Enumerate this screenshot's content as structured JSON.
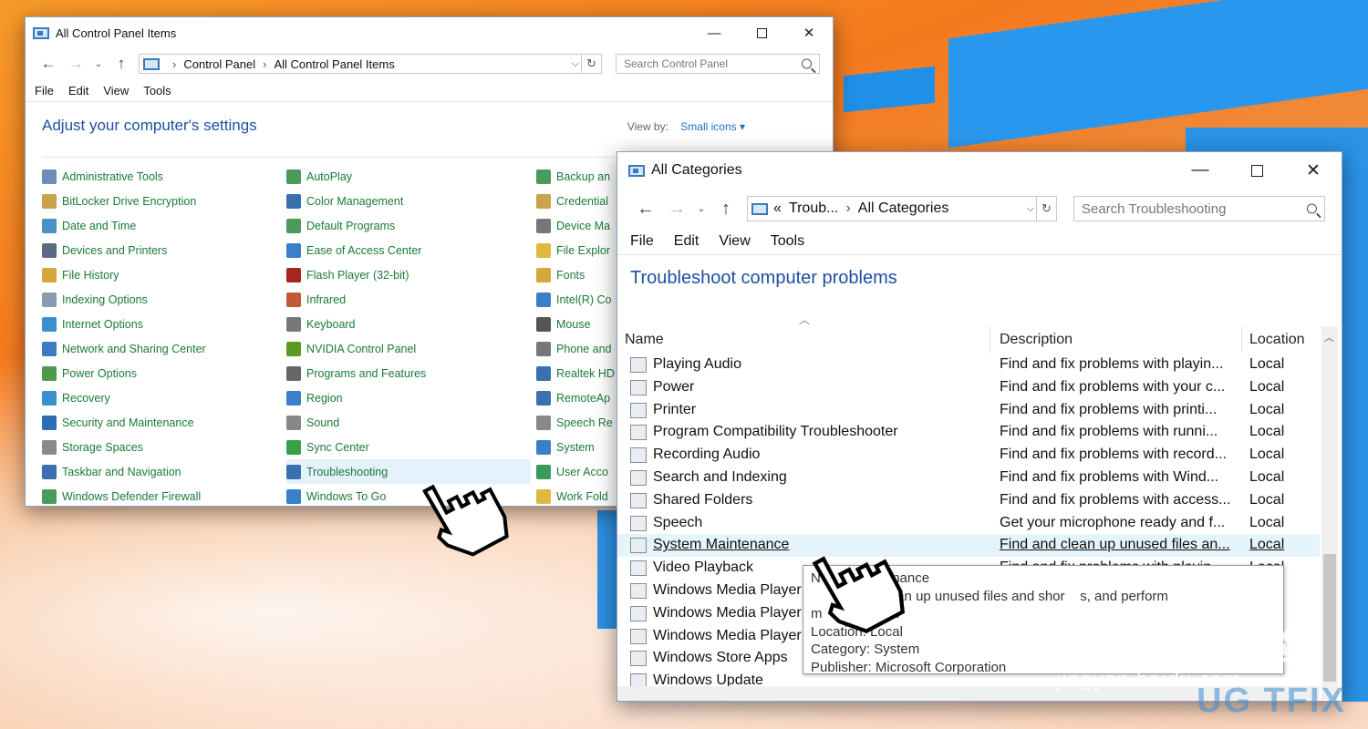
{
  "control_panel": {
    "title": "All Control Panel Items",
    "nav": {
      "back": "←",
      "forward": "→",
      "recent": "⌄",
      "up": "↑"
    },
    "breadcrumb": [
      "Control Panel",
      "All Control Panel Items"
    ],
    "search_placeholder": "Search Control Panel",
    "menu": [
      "File",
      "Edit",
      "View",
      "Tools"
    ],
    "heading": "Adjust your computer's settings",
    "view_by_label": "View by:",
    "view_by_value": "Small icons ▾",
    "columns": [
      [
        {
          "label": "Administrative Tools",
          "icon": "admin-tools-icon",
          "color": "#6c8fb8"
        },
        {
          "label": "BitLocker Drive Encryption",
          "icon": "bitlocker-icon",
          "color": "#c9a24a"
        },
        {
          "label": "Date and Time",
          "icon": "clock-icon",
          "color": "#4a90c9"
        },
        {
          "label": "Devices and Printers",
          "icon": "printer-icon",
          "color": "#5a6d80"
        },
        {
          "label": "File History",
          "icon": "file-history-icon",
          "color": "#d4a93c"
        },
        {
          "label": "Indexing Options",
          "icon": "indexing-icon",
          "color": "#8a9bb0"
        },
        {
          "label": "Internet Options",
          "icon": "globe-icon",
          "color": "#3a8fcf"
        },
        {
          "label": "Network and Sharing Center",
          "icon": "network-icon",
          "color": "#3d7cc0"
        },
        {
          "label": "Power Options",
          "icon": "power-icon",
          "color": "#4f9a4a"
        },
        {
          "label": "Recovery",
          "icon": "recovery-icon",
          "color": "#3a8fcf"
        },
        {
          "label": "Security and Maintenance",
          "icon": "flag-icon",
          "color": "#2e6db4"
        },
        {
          "label": "Storage Spaces",
          "icon": "storage-icon",
          "color": "#8a8a8a"
        },
        {
          "label": "Taskbar and Navigation",
          "icon": "taskbar-icon",
          "color": "#3a6fb0"
        },
        {
          "label": "Windows Defender Firewall",
          "icon": "firewall-icon",
          "color": "#4a9a5a"
        }
      ],
      [
        {
          "label": "AutoPlay",
          "icon": "autoplay-icon",
          "color": "#4a9a5a"
        },
        {
          "label": "Color Management",
          "icon": "color-icon",
          "color": "#3a6fb0"
        },
        {
          "label": "Default Programs",
          "icon": "default-programs-icon",
          "color": "#4a9a5a"
        },
        {
          "label": "Ease of Access Center",
          "icon": "ease-access-icon",
          "color": "#3a7fc9"
        },
        {
          "label": "Flash Player (32-bit)",
          "icon": "flash-icon",
          "color": "#a8241e"
        },
        {
          "label": "Infrared",
          "icon": "infrared-icon",
          "color": "#c25a3a"
        },
        {
          "label": "Keyboard",
          "icon": "keyboard-icon",
          "color": "#777777"
        },
        {
          "label": "NVIDIA Control Panel",
          "icon": "nvidia-icon",
          "color": "#5a9a22"
        },
        {
          "label": "Programs and Features",
          "icon": "programs-icon",
          "color": "#666666"
        },
        {
          "label": "Region",
          "icon": "region-icon",
          "color": "#3a7fc9"
        },
        {
          "label": "Sound",
          "icon": "sound-icon",
          "color": "#888888"
        },
        {
          "label": "Sync Center",
          "icon": "sync-icon",
          "color": "#3aa04a"
        },
        {
          "label": "Troubleshooting",
          "icon": "troubleshooting-icon",
          "color": "#3a6fb0"
        },
        {
          "label": "Windows To Go",
          "icon": "windows-to-go-icon",
          "color": "#3a7fc9"
        }
      ],
      [
        {
          "label": "Backup an",
          "icon": "backup-icon",
          "color": "#4a9a5a"
        },
        {
          "label": "Credential",
          "icon": "credential-icon",
          "color": "#c9a24a"
        },
        {
          "label": "Device Ma",
          "icon": "device-manager-icon",
          "color": "#777777"
        },
        {
          "label": "File Explor",
          "icon": "folder-icon",
          "color": "#e0b840"
        },
        {
          "label": "Fonts",
          "icon": "fonts-icon",
          "color": "#d4a93c"
        },
        {
          "label": "Intel(R) Co",
          "icon": "intel-icon",
          "color": "#3a7fc9"
        },
        {
          "label": "Mouse",
          "icon": "mouse-icon",
          "color": "#555555"
        },
        {
          "label": "Phone and",
          "icon": "phone-icon",
          "color": "#777777"
        },
        {
          "label": "Realtek HD",
          "icon": "realtek-icon",
          "color": "#3a6fb0"
        },
        {
          "label": "RemoteAp",
          "icon": "remoteapp-icon",
          "color": "#3a6fb0"
        },
        {
          "label": "Speech Re",
          "icon": "microphone-icon",
          "color": "#888888"
        },
        {
          "label": "System",
          "icon": "system-icon",
          "color": "#3a7fc9"
        },
        {
          "label": "User Acco",
          "icon": "user-accounts-icon",
          "color": "#3a9a5a"
        },
        {
          "label": "Work Fold",
          "icon": "work-folders-icon",
          "color": "#e0b840"
        }
      ]
    ]
  },
  "troubleshoot": {
    "title": "All Categories",
    "nav": {
      "back": "←",
      "forward": "→",
      "recent": "⌄",
      "up": "↑"
    },
    "breadcrumb_prefix": "«",
    "breadcrumb": [
      "Troub...",
      "All Categories"
    ],
    "search_placeholder": "Search Troubleshooting",
    "menu": [
      "File",
      "Edit",
      "View",
      "Tools"
    ],
    "heading": "Troubleshoot computer problems",
    "columns": {
      "name": "Name",
      "description": "Description",
      "location": "Location"
    },
    "rows": [
      {
        "name": "Playing Audio",
        "description": "Find and fix problems with playin...",
        "location": "Local"
      },
      {
        "name": "Power",
        "description": "Find and fix problems with your c...",
        "location": "Local"
      },
      {
        "name": "Printer",
        "description": "Find and fix problems with printi...",
        "location": "Local"
      },
      {
        "name": "Program Compatibility Troubleshooter",
        "description": "Find and fix problems with runni...",
        "location": "Local"
      },
      {
        "name": "Recording Audio",
        "description": "Find and fix problems with record...",
        "location": "Local"
      },
      {
        "name": "Search and Indexing",
        "description": "Find and fix problems with Wind...",
        "location": "Local"
      },
      {
        "name": "Shared Folders",
        "description": "Find and fix problems with access...",
        "location": "Local"
      },
      {
        "name": "Speech",
        "description": "Get your microphone ready and f...",
        "location": "Local"
      },
      {
        "name": "System Maintenance",
        "description": "Find and clean up unused files an...",
        "location": "Local",
        "highlighted": true
      },
      {
        "name": "Video Playback",
        "description": "Find and fix problems with playin...",
        "location": "Local"
      },
      {
        "name": "Windows Media Player",
        "description": "",
        "location": ""
      },
      {
        "name": "Windows Media Player",
        "description": "",
        "location": ""
      },
      {
        "name": "Windows Media Player",
        "description": "",
        "location": ""
      },
      {
        "name": "Windows Store Apps",
        "description": "",
        "location": ""
      },
      {
        "name": "Windows Update",
        "description": "",
        "location": ""
      }
    ],
    "tooltip": {
      "line1": "N        Maintenance",
      "line2": "        d and clean up unused files and shor    s, and perform",
      "line3": "m              sks.",
      "line4": "Location: Local",
      "line5": "Category: System",
      "line6": "Publisher: Microsoft Corporation"
    }
  },
  "watermarks": {
    "baidu": "Bai du 经验",
    "baidu_url": "jingyan.baidu.com",
    "ugetfix": "UG  TFIX"
  }
}
